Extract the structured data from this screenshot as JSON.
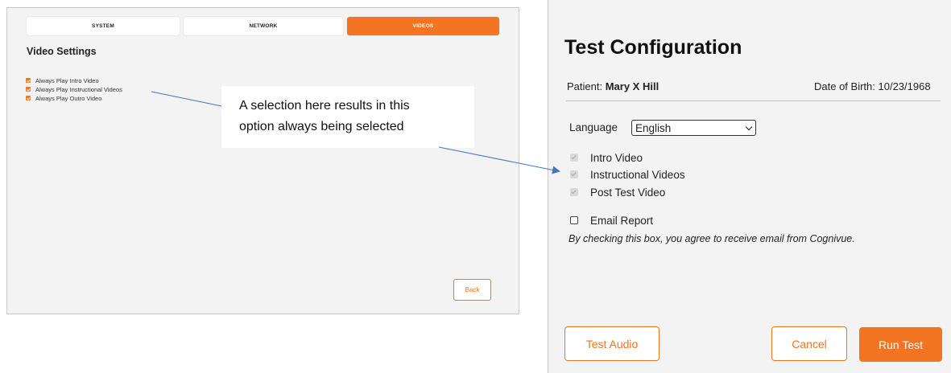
{
  "left_panel": {
    "tabs": [
      {
        "label": "SYSTEM",
        "active": false
      },
      {
        "label": "NETWORK",
        "active": false
      },
      {
        "label": "VIDEOS",
        "active": true
      }
    ],
    "section_title": "Video Settings",
    "options": [
      {
        "label": "Always Play Intro Video",
        "checked": true
      },
      {
        "label": "Always Play Instructional Videos",
        "checked": true
      },
      {
        "label": "Always Play Outro Video",
        "checked": true
      }
    ],
    "back_label": "Back"
  },
  "annotation": {
    "line1": "A selection here results in this",
    "line2": "option always being selected"
  },
  "right_panel": {
    "title": "Test Configuration",
    "patient_label": "Patient:",
    "patient_name": "Mary X Hill",
    "dob_label": "Date of Birth:",
    "dob_value": "10/23/1968",
    "language_label": "Language",
    "language_value": "English",
    "video_options": [
      {
        "label": "Intro Video",
        "checked": true,
        "disabled": true
      },
      {
        "label": "Instructional Videos",
        "checked": true,
        "disabled": true
      },
      {
        "label": "Post Test Video",
        "checked": true,
        "disabled": true
      }
    ],
    "email_label": "Email Report",
    "email_checked": false,
    "email_note": "By checking this box, you agree to receive email from Cognivue.",
    "buttons": {
      "test_audio": "Test Audio",
      "cancel": "Cancel",
      "run_test": "Run Test"
    }
  },
  "colors": {
    "accent": "#f47521",
    "arrow": "#4472c4"
  }
}
